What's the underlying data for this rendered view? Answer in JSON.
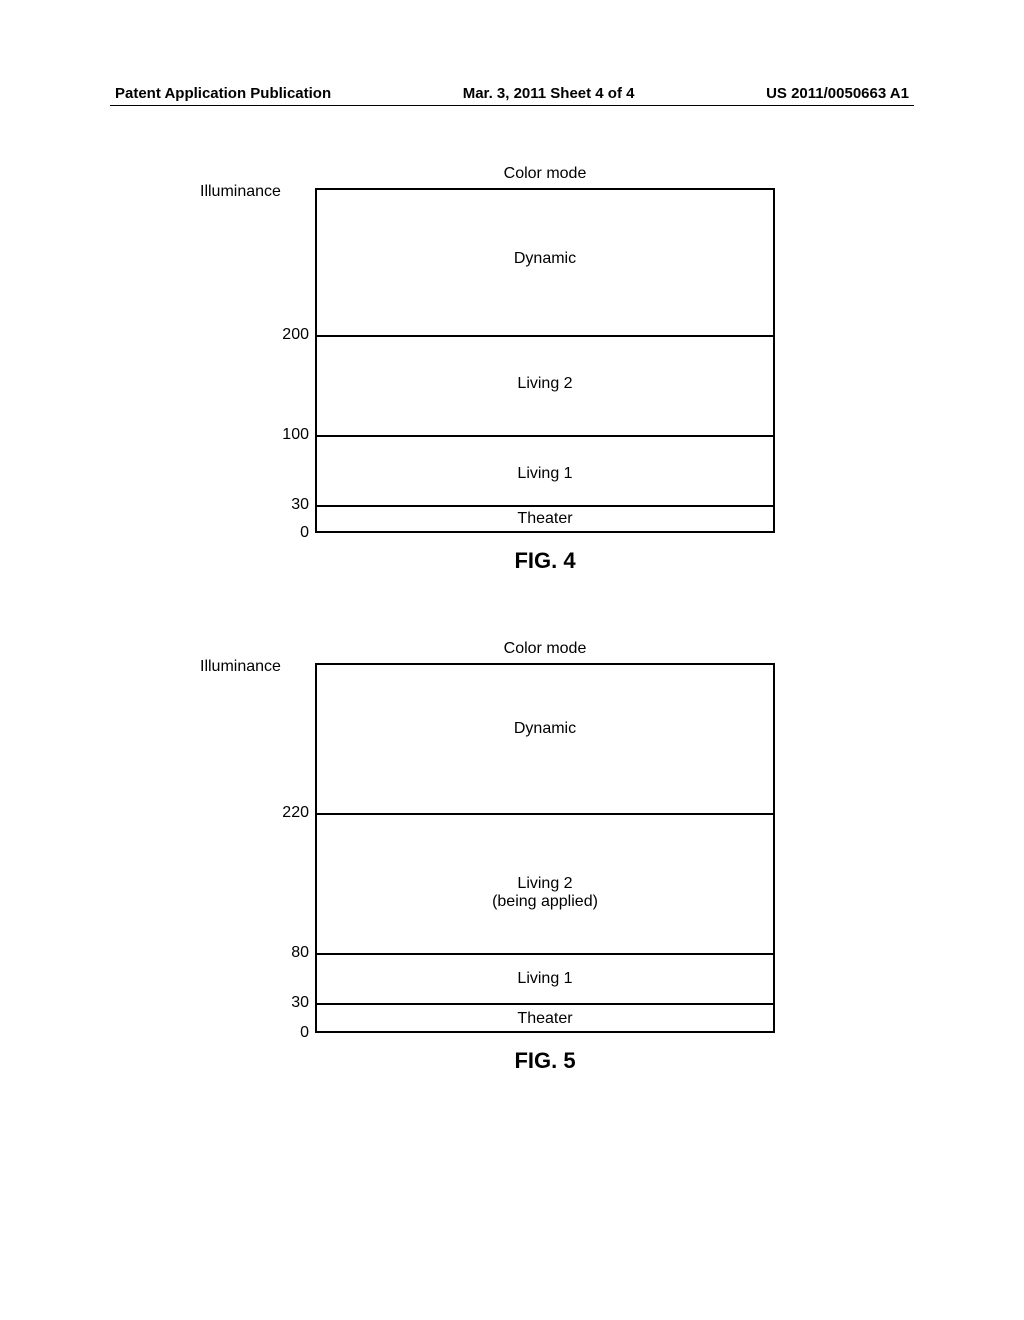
{
  "header": {
    "left": "Patent Application Publication",
    "center": "Mar. 3, 2011  Sheet 4 of 4",
    "right": "US 2011/0050663 A1"
  },
  "fig4": {
    "title": "Color mode",
    "ylabel": "Illuminance",
    "label": "FIG. 4",
    "ticks": {
      "v0": "0",
      "v30": "30",
      "v100": "100",
      "v200": "200"
    },
    "regions": {
      "theater": "Theater",
      "living1": "Living 1",
      "living2": "Living 2",
      "dynamic": "Dynamic"
    }
  },
  "fig5": {
    "title": "Color mode",
    "ylabel": "Illuminance",
    "label": "FIG. 5",
    "ticks": {
      "v0": "0",
      "v30": "30",
      "v80": "80",
      "v220": "220"
    },
    "regions": {
      "theater": "Theater",
      "living1": "Living 1",
      "living2_line1": "Living 2",
      "living2_line2": "(being applied)",
      "dynamic": "Dynamic"
    }
  },
  "chart_data": [
    {
      "type": "table",
      "title": "Color mode",
      "ylabel": "Illuminance",
      "figure": "FIG. 4",
      "bands": [
        {
          "label": "Theater",
          "from": 0,
          "to": 30
        },
        {
          "label": "Living 1",
          "from": 30,
          "to": 100
        },
        {
          "label": "Living 2",
          "from": 100,
          "to": 200
        },
        {
          "label": "Dynamic",
          "from": 200,
          "to": null
        }
      ]
    },
    {
      "type": "table",
      "title": "Color mode",
      "ylabel": "Illuminance",
      "figure": "FIG. 5",
      "bands": [
        {
          "label": "Theater",
          "from": 0,
          "to": 30
        },
        {
          "label": "Living 1",
          "from": 30,
          "to": 80
        },
        {
          "label": "Living 2 (being applied)",
          "from": 80,
          "to": 220
        },
        {
          "label": "Dynamic",
          "from": 220,
          "to": null
        }
      ]
    }
  ]
}
